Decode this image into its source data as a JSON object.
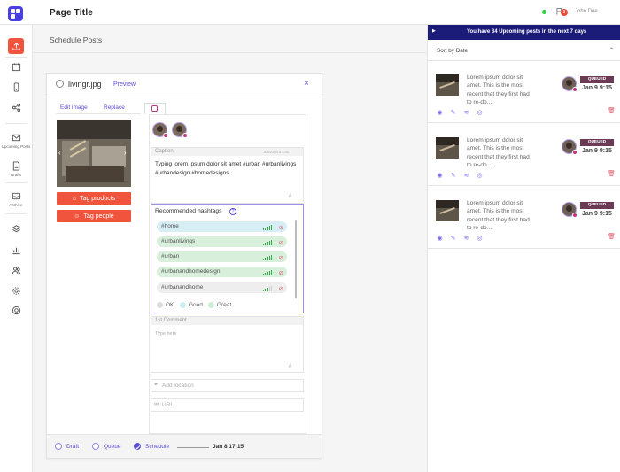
{
  "header": {
    "page_title": "Page Title",
    "user_name": "John Doe",
    "notification_count": "3"
  },
  "sidebar": {
    "items": [
      {
        "icon": "upload-icon",
        "label": ""
      },
      {
        "icon": "calendar-icon",
        "label": ""
      },
      {
        "icon": "mobile-icon",
        "label": ""
      },
      {
        "icon": "share-icon",
        "label": ""
      },
      {
        "icon": "mail-icon",
        "label": "Upcoming Posts"
      },
      {
        "icon": "document-icon",
        "label": "Drafts"
      },
      {
        "icon": "archive-icon",
        "label": "Archive"
      },
      {
        "icon": "layers-icon",
        "label": ""
      },
      {
        "icon": "chart-icon",
        "label": ""
      },
      {
        "icon": "users-icon",
        "label": ""
      },
      {
        "icon": "gear-icon",
        "label": ""
      },
      {
        "icon": "help-icon",
        "label": ""
      }
    ]
  },
  "main": {
    "section_title": "Schedule Posts"
  },
  "modal": {
    "filename": "livingr.jpg",
    "preview_label": "Preview",
    "close_label": "×",
    "edit_image_label": "Edit image",
    "replace_label": "Replace",
    "tag_products_label": "Tag products",
    "tag_people_label": "Tag people",
    "caption": {
      "label": "Caption",
      "count": "A 8/2200  # 4/30",
      "text": "Typing lorem ipsum dolor sit amet #urban #urbanlivings #urbandesign #homedesigns",
      "hash_symbol": "#"
    },
    "hashtags": {
      "title": "Recommended hashtags",
      "help": "?",
      "items": [
        {
          "tag": "#home",
          "color": "#d6eef4",
          "strength": 5
        },
        {
          "tag": "#urbanlivings",
          "color": "#d7efdb",
          "strength": 5
        },
        {
          "tag": "#urban",
          "color": "#d7efdb",
          "strength": 5
        },
        {
          "tag": "#urbanandhomedesign",
          "color": "#d7efdb",
          "strength": 5
        },
        {
          "tag": "#urbanandhome",
          "color": "#eeeeee",
          "strength": 3
        }
      ],
      "legend": [
        {
          "label": "OK",
          "color": "#dddddd"
        },
        {
          "label": "Good",
          "color": "#cfeef4"
        },
        {
          "label": "Great",
          "color": "#cfeed8"
        }
      ]
    },
    "first_comment": {
      "label": "1st Comment",
      "placeholder": "Type here",
      "hash_symbol": "#"
    },
    "location_placeholder": "Add location",
    "url_placeholder": "URL",
    "footer": {
      "options": [
        "Draft",
        "Queue",
        "Schedule"
      ],
      "selected": "Schedule",
      "date": "Jan 8 17:15"
    }
  },
  "upcoming": {
    "banner": "You have 34 Upcoming posts in the next 7 days",
    "sort_label": "Sort by Date",
    "cards": [
      {
        "text": "Lorem ipsum dolor sit amet. This is the most recent that they first had to re-do...",
        "status": "QUEUED",
        "date": "Jan 9 9:15"
      },
      {
        "text": "Lorem ipsum dolor sit amet. This is the most recent that they first had to re-do...",
        "status": "QUEUED",
        "date": "Jan 9 9:15"
      },
      {
        "text": "Lorem ipsum dolor sit amet. This is the most recent that they first had to re-do...",
        "status": "QUEUED",
        "date": "Jan 9 9:15"
      }
    ]
  },
  "colors": {
    "accent": "#5a4fd6",
    "brand_orange": "#f0543c",
    "banner": "#1b1b7a",
    "queued_badge": "#6b3a55"
  }
}
